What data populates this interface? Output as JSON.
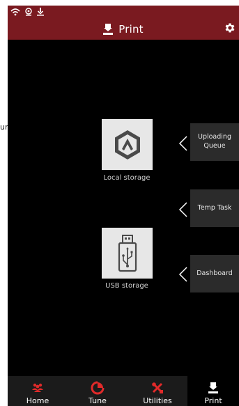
{
  "header": {
    "title": "Print",
    "title_icon": "print-icon",
    "status_icons": [
      "wifi-icon",
      "camera-icon",
      "download-icon"
    ],
    "settings_icon": "gear-icon"
  },
  "stray_text": "ur",
  "storage": [
    {
      "label": "Local storage",
      "icon": "local-storage-icon"
    },
    {
      "label": "USB storage",
      "icon": "usb-icon"
    }
  ],
  "side_panels": [
    {
      "line1": "Uploading",
      "line2": "Queue"
    },
    {
      "line1": "Temp Task",
      "line2": ""
    },
    {
      "line1": "Dashboard",
      "line2": ""
    }
  ],
  "nav": [
    {
      "label": "Home",
      "icon": "home-icon"
    },
    {
      "label": "Tune",
      "icon": "tune-icon"
    },
    {
      "label": "Utilities",
      "icon": "utilities-icon"
    },
    {
      "label": "Print",
      "icon": "print-icon",
      "active": true
    }
  ],
  "colors": {
    "accent": "#7a1a20",
    "nav_icon_red": "#e02a2a",
    "tile_bg": "#e7e7e7"
  }
}
